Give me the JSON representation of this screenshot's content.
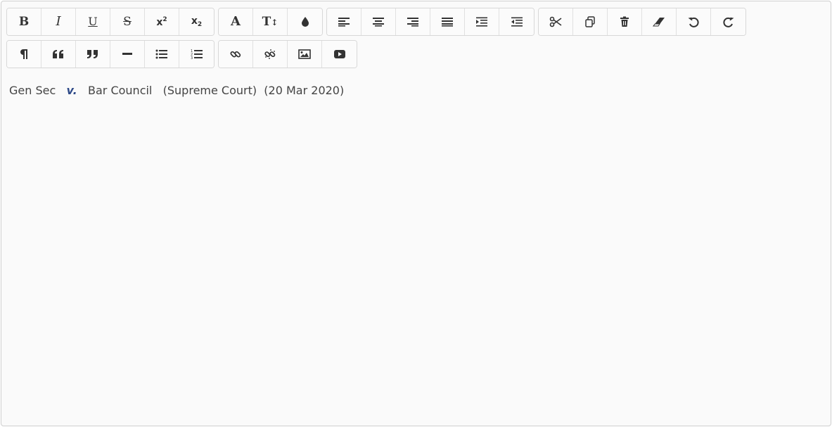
{
  "toolbar": {
    "row1": [
      [
        {
          "name": "bold-button",
          "icon": "bold-icon",
          "glyph": "B"
        },
        {
          "name": "italic-button",
          "icon": "italic-icon",
          "glyph": "I"
        },
        {
          "name": "underline-button",
          "icon": "underline-icon",
          "glyph": "U"
        },
        {
          "name": "strikethrough-button",
          "icon": "strikethrough-icon",
          "glyph": "S"
        },
        {
          "name": "superscript-button",
          "icon": "superscript-icon",
          "glyph": "x",
          "small": "2"
        },
        {
          "name": "subscript-button",
          "icon": "subscript-icon",
          "glyph": "x",
          "small": "2"
        }
      ],
      [
        {
          "name": "font-button",
          "icon": "font-icon",
          "glyph": "A"
        },
        {
          "name": "font-size-button",
          "icon": "text-height-icon",
          "glyph": "T"
        },
        {
          "name": "text-color-button",
          "icon": "color-drop-icon"
        }
      ],
      [
        {
          "name": "align-left-button",
          "icon": "align-left-icon"
        },
        {
          "name": "align-center-button",
          "icon": "align-center-icon"
        },
        {
          "name": "align-right-button",
          "icon": "align-right-icon"
        },
        {
          "name": "align-justify-button",
          "icon": "align-justify-icon"
        },
        {
          "name": "indent-button",
          "icon": "indent-icon"
        },
        {
          "name": "outdent-button",
          "icon": "outdent-icon"
        }
      ],
      [
        {
          "name": "cut-button",
          "icon": "scissors-icon"
        },
        {
          "name": "copy-button",
          "icon": "copy-icon"
        },
        {
          "name": "delete-button",
          "icon": "trash-icon"
        },
        {
          "name": "clear-format-button",
          "icon": "eraser-icon"
        },
        {
          "name": "undo-button",
          "icon": "undo-icon"
        },
        {
          "name": "redo-button",
          "icon": "redo-icon"
        }
      ]
    ],
    "row2": [
      [
        {
          "name": "paragraph-button",
          "icon": "paragraph-icon"
        },
        {
          "name": "quote-left-button",
          "icon": "quote-left-icon"
        },
        {
          "name": "quote-right-button",
          "icon": "quote-right-icon"
        },
        {
          "name": "horizontal-rule-button",
          "icon": "minus-icon"
        },
        {
          "name": "bullet-list-button",
          "icon": "list-ul-icon"
        },
        {
          "name": "numbered-list-button",
          "icon": "list-ol-icon"
        }
      ],
      [
        {
          "name": "link-button",
          "icon": "link-icon"
        },
        {
          "name": "unlink-button",
          "icon": "unlink-icon"
        },
        {
          "name": "image-button",
          "icon": "image-icon"
        },
        {
          "name": "video-button",
          "icon": "youtube-icon"
        }
      ]
    ]
  },
  "content": {
    "party1": "Gen Sec",
    "versus": "v.",
    "party2": "Bar Council",
    "court": "(Supreme Court)",
    "date": "(20 Mar 2020)"
  },
  "colors": {
    "versus": "#2e4a88",
    "text": "#444444",
    "icon": "#333333"
  }
}
